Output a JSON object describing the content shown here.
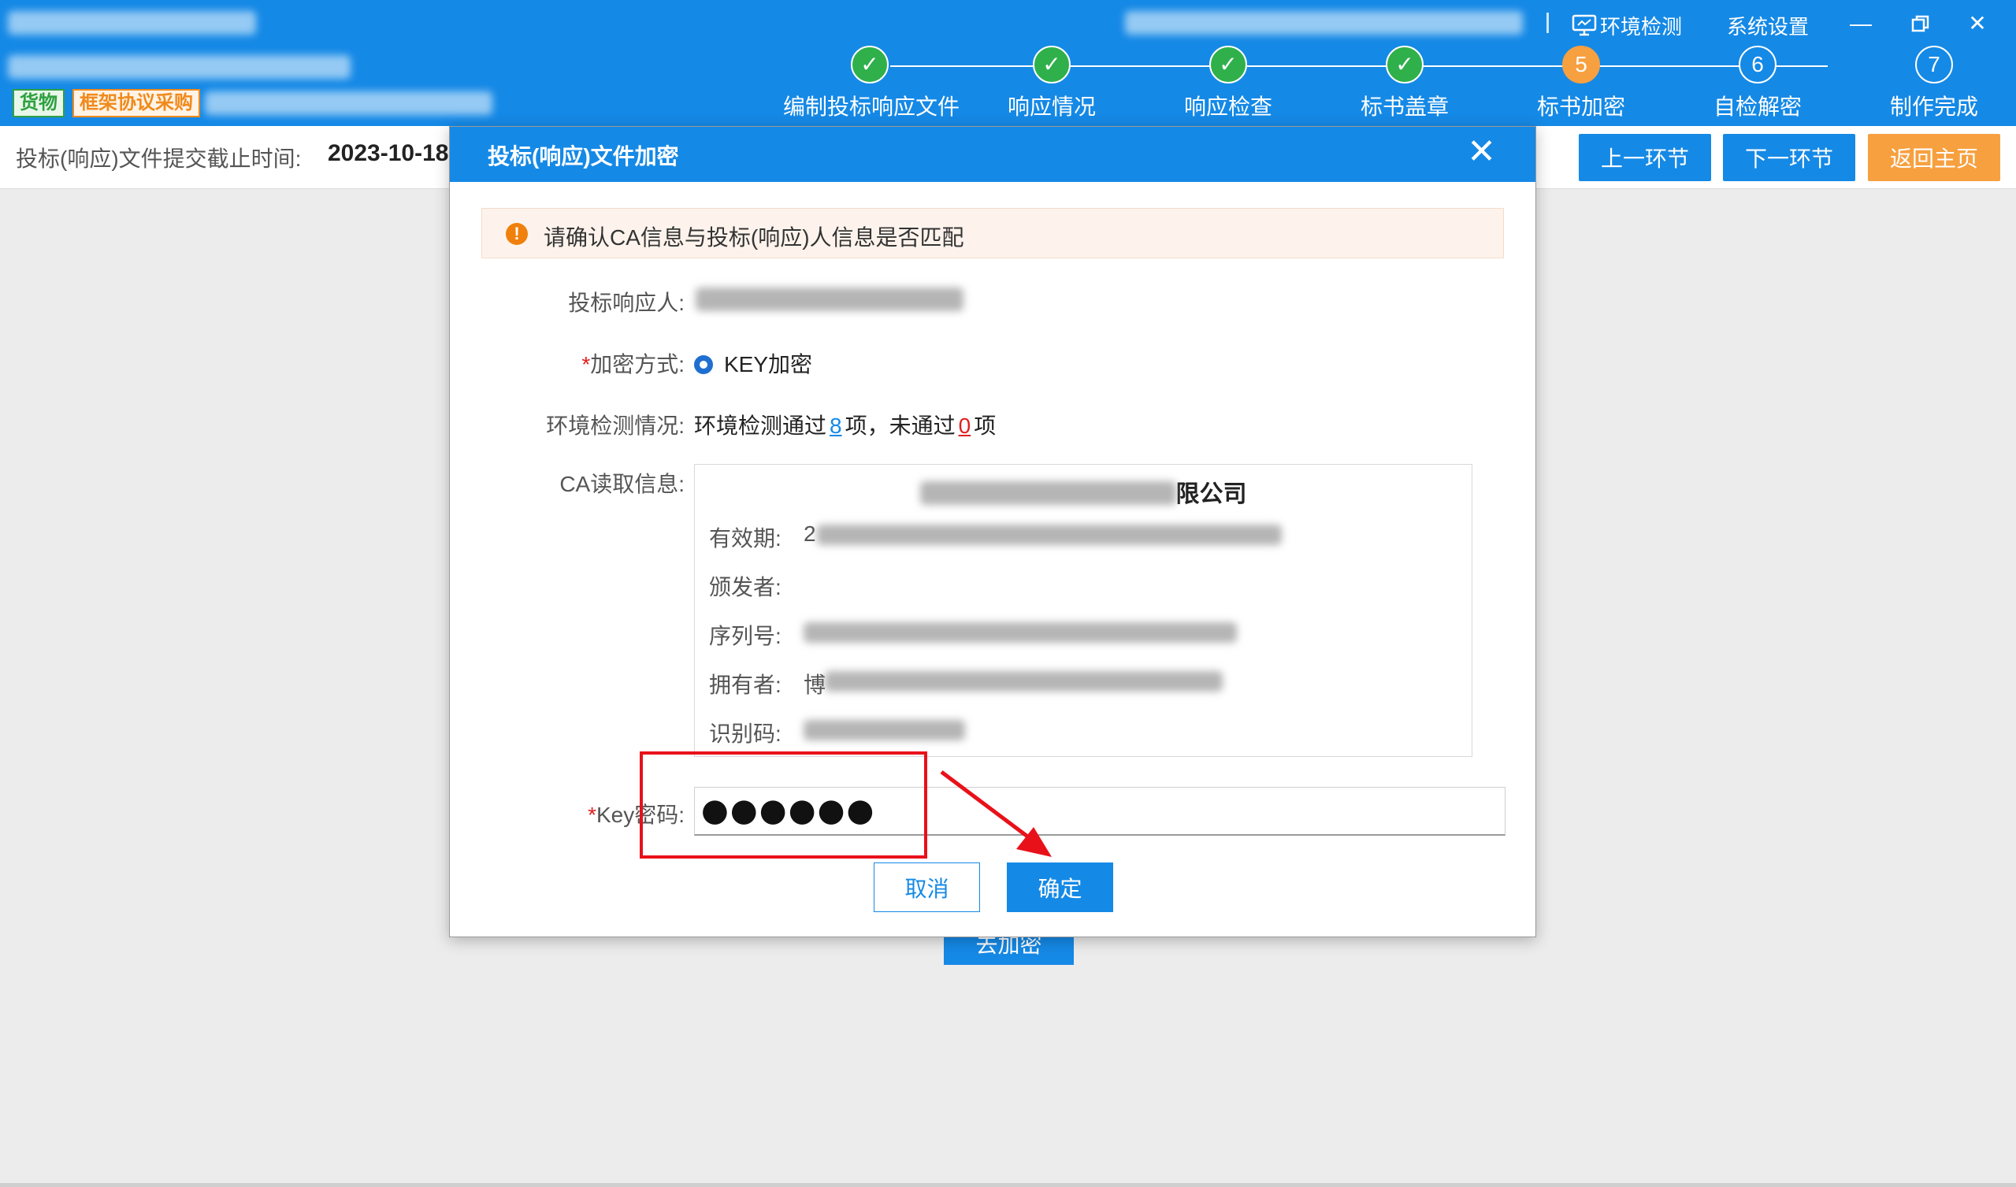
{
  "header": {
    "tags": [
      "货物",
      "框架协议采购"
    ],
    "links": {
      "env_check": "环境检测",
      "settings": "系统设置"
    },
    "steps": [
      {
        "label": "编制投标响应文件",
        "num": "1",
        "status": "done"
      },
      {
        "label": "响应情况",
        "num": "2",
        "status": "done"
      },
      {
        "label": "响应检查",
        "num": "3",
        "status": "done"
      },
      {
        "label": "标书盖章",
        "num": "4",
        "status": "done"
      },
      {
        "label": "标书加密",
        "num": "5",
        "status": "active"
      },
      {
        "label": "自检解密",
        "num": "6",
        "status": "todo"
      },
      {
        "label": "制作完成",
        "num": "7",
        "status": "todo"
      }
    ]
  },
  "subbar": {
    "deadline_label": "投标(响应)文件提交截止时间:",
    "deadline_value": "2023-10-18",
    "prev_btn": "上一环节",
    "next_btn": "下一环节",
    "home_btn": "返回主页"
  },
  "background_button": "去加密",
  "modal": {
    "title": "投标(响应)文件加密",
    "warning": "请确认CA信息与投标(响应)人信息是否匹配",
    "bidder_label": "投标响应人:",
    "encrypt_label": "加密方式:",
    "encrypt_value": "KEY加密",
    "env_label": "环境检测情况:",
    "env_prefix": "环境检测通过",
    "env_pass": "8",
    "env_mid": "项，未通过",
    "env_fail": "0",
    "env_suffix": "项",
    "ca_label": "CA读取信息:",
    "ca": {
      "company_suffix": "限公司",
      "validity_label": "有效期:",
      "validity_prefix": "2",
      "issuer_label": "颁发者:",
      "serial_label": "序列号:",
      "owner_label": "拥有者:",
      "owner_prefix": "博",
      "id_label": "识别码:"
    },
    "key_label": "Key密码:",
    "key_value": "●●●●●●",
    "cancel_btn": "取消",
    "ok_btn": "确定"
  },
  "colors": {
    "primary": "#1589e6",
    "accent_orange": "#f7a040",
    "done_green": "#2fb04b",
    "annotation_red": "#e8111a"
  }
}
